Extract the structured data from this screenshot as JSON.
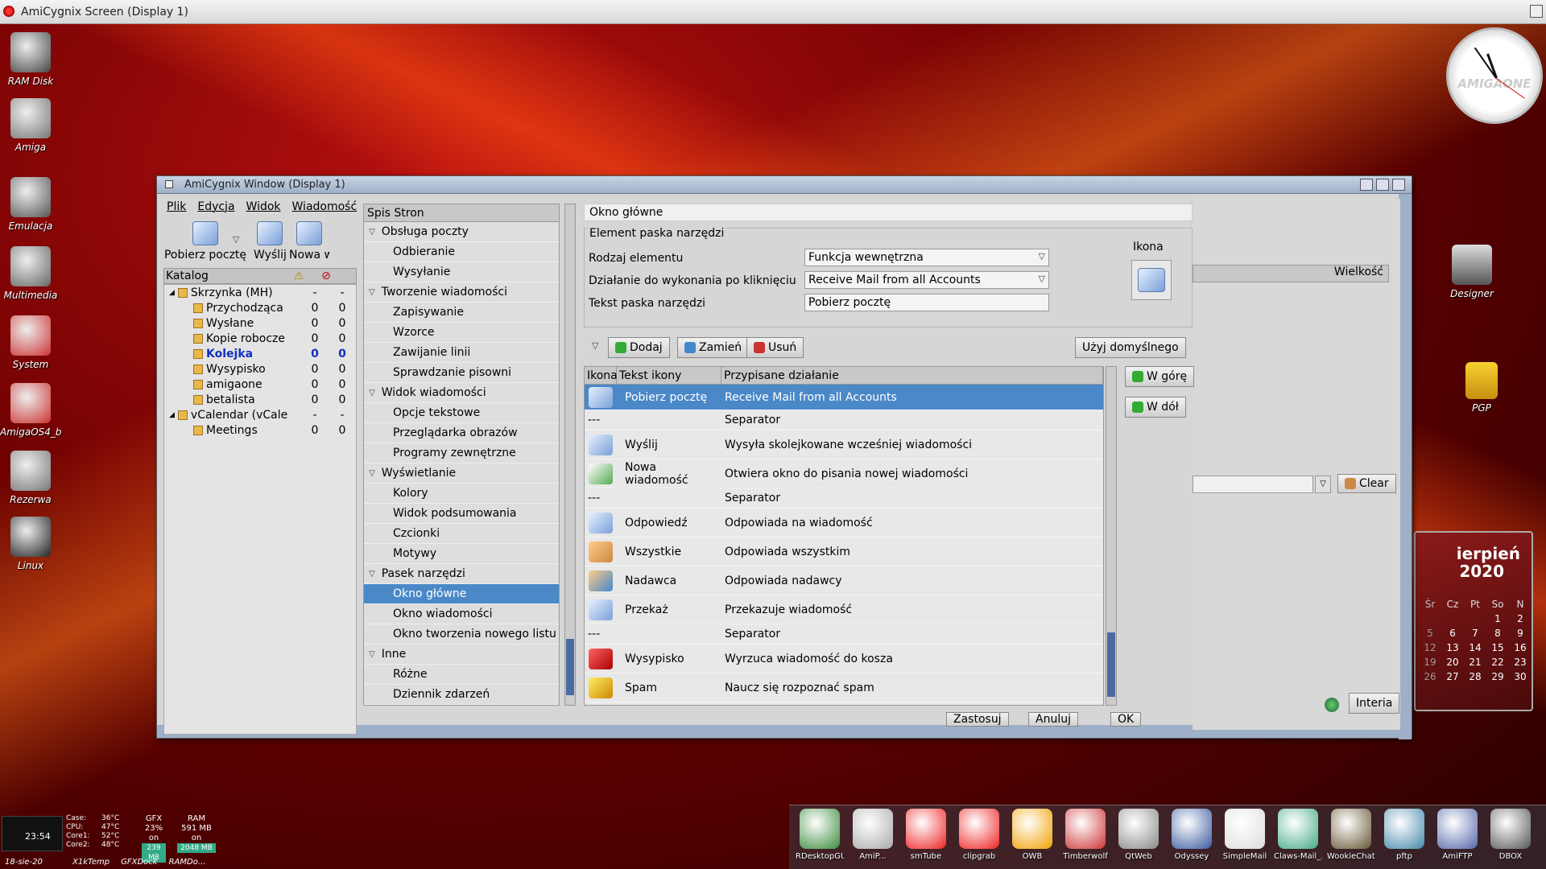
{
  "screen": {
    "title": "AmiCygnix Screen (Display 1)"
  },
  "desktop_icons": [
    {
      "label": "RAM Disk",
      "icon": "ramdisk-icon",
      "color": "#444"
    },
    {
      "label": "Amiga",
      "icon": "amiga-tools-icon",
      "color": "#777"
    },
    {
      "label": "Emulacja",
      "icon": "emulation-icon",
      "color": "#555"
    },
    {
      "label": "Multimedia",
      "icon": "film-reel-icon",
      "color": "#666"
    },
    {
      "label": "System",
      "icon": "boing-ball-icon",
      "color": "#c33"
    },
    {
      "label": "AmigaOS4_b",
      "icon": "boing-ball-icon",
      "color": "#c33"
    },
    {
      "label": "Rezerwa",
      "icon": "tools-icon",
      "color": "#777"
    },
    {
      "label": "Linux",
      "icon": "penguin-icon",
      "color": "#222"
    }
  ],
  "desktop_icons_right": [
    {
      "label": "Designer",
      "icon": "hollywood-clapper-icon"
    },
    {
      "label": "PGP",
      "icon": "padlock-icon"
    }
  ],
  "clock": {
    "brand": "AMIGAONE"
  },
  "calendar": {
    "month": "ierpień",
    "year": "2020",
    "days_header": [
      "Cz",
      "Pt",
      "So",
      "N"
    ],
    "weeks": [
      [
        "",
        "",
        "",
        "1",
        "2"
      ],
      [
        "5",
        "6",
        "7",
        "8",
        "9"
      ],
      [
        "12",
        "13",
        "14",
        "15",
        "16"
      ],
      [
        "19",
        "20",
        "21",
        "22",
        "23"
      ],
      [
        "26",
        "27",
        "28",
        "29",
        "30"
      ]
    ],
    "col_label": "Śr"
  },
  "window": {
    "title": "AmiCygnix Window (Display 1)",
    "menu": [
      "Plik",
      "Edycja",
      "Widok",
      "Wiadomość"
    ],
    "toolbar": [
      {
        "label": "Pobierz pocztę",
        "icon": "get-mail-icon"
      },
      {
        "label": "Wyślij",
        "icon": "send-mail-icon"
      },
      {
        "label": "Nowa w",
        "icon": "new-message-icon"
      }
    ],
    "folder_header": {
      "katalog": "Katalog"
    },
    "folders": [
      {
        "name": "Skrzynka (MH)",
        "a": "-",
        "b": "-",
        "indent": 0,
        "bold": false
      },
      {
        "name": "Przychodząca",
        "a": "0",
        "b": "0",
        "indent": 1,
        "bold": false
      },
      {
        "name": "Wysłane",
        "a": "0",
        "b": "0",
        "indent": 1,
        "bold": false
      },
      {
        "name": "Kopie robocze",
        "a": "0",
        "b": "0",
        "indent": 1,
        "bold": false
      },
      {
        "name": "Kolejka",
        "a": "0",
        "b": "0",
        "indent": 1,
        "bold": true
      },
      {
        "name": "Wysypisko",
        "a": "0",
        "b": "0",
        "indent": 1,
        "bold": false
      },
      {
        "name": "amigaone",
        "a": "0",
        "b": "0",
        "indent": 1,
        "bold": false
      },
      {
        "name": "betalista",
        "a": "0",
        "b": "0",
        "indent": 1,
        "bold": false
      },
      {
        "name": "vCalendar (vCale",
        "a": "-",
        "b": "-",
        "indent": 0,
        "bold": false
      },
      {
        "name": "Meetings",
        "a": "0",
        "b": "0",
        "indent": 1,
        "bold": false
      }
    ],
    "pages_header": "Spis Stron",
    "pages": [
      {
        "label": "Obsługa poczty",
        "type": "cat"
      },
      {
        "label": "Odbieranie",
        "type": "sub"
      },
      {
        "label": "Wysyłanie",
        "type": "sub"
      },
      {
        "label": "Tworzenie wiadomości",
        "type": "cat"
      },
      {
        "label": "Zapisywanie",
        "type": "sub"
      },
      {
        "label": "Wzorce",
        "type": "sub"
      },
      {
        "label": "Zawijanie linii",
        "type": "sub"
      },
      {
        "label": "Sprawdzanie pisowni",
        "type": "sub"
      },
      {
        "label": "Widok wiadomości",
        "type": "cat"
      },
      {
        "label": "Opcje tekstowe",
        "type": "sub"
      },
      {
        "label": "Przeglądarka obrazów",
        "type": "sub"
      },
      {
        "label": "Programy zewnętrzne",
        "type": "sub"
      },
      {
        "label": "Wyświetlanie",
        "type": "cat"
      },
      {
        "label": "Kolory",
        "type": "sub"
      },
      {
        "label": "Widok podsumowania",
        "type": "sub"
      },
      {
        "label": "Czcionki",
        "type": "sub"
      },
      {
        "label": "Motywy",
        "type": "sub"
      },
      {
        "label": "Pasek narzędzi",
        "type": "cat"
      },
      {
        "label": "Okno główne",
        "type": "sub",
        "selected": true
      },
      {
        "label": "Okno wiadomości",
        "type": "sub"
      },
      {
        "label": "Okno tworzenia nowego listu",
        "type": "sub"
      },
      {
        "label": "Inne",
        "type": "cat"
      },
      {
        "label": "Różne",
        "type": "sub"
      },
      {
        "label": "Dziennik zdarzeń",
        "type": "sub"
      }
    ],
    "panel": {
      "title": "Okno główne",
      "group_title": "Element paska narzędzi",
      "rodzaj_label": "Rodzaj elementu",
      "rodzaj_value": "Funkcja wewnętrzna",
      "dzialanie_label": "Działanie do wykonania po kliknięciu",
      "dzialanie_value": "Receive Mail from all Accounts",
      "tekst_label": "Tekst paska narzędzi",
      "tekst_value": "Pobierz pocztę",
      "ikona_label": "Ikona",
      "btn_dodaj": "Dodaj",
      "btn_zamien": "Zamień",
      "btn_usun": "Usuń",
      "btn_domyslne": "Użyj domyślnego",
      "btn_wgore": "W górę",
      "btn_wdol": "W dół",
      "col_ikona": "Ikona",
      "col_tekst": "Tekst ikony",
      "col_dzialanie": "Przypisane działanie",
      "btn_zastosuj": "Zastosuj",
      "btn_anuluj": "Anuluj",
      "btn_ok": "OK"
    },
    "rows": [
      {
        "text": "Pobierz pocztę",
        "action": "Receive Mail from all Accounts",
        "icon": "get-mail-icon",
        "selected": true,
        "sep": false
      },
      {
        "text": "---",
        "action": "Separator",
        "icon": "",
        "sep": true
      },
      {
        "text": "Wyślij",
        "action": "Wysyła skolejkowane wcześniej wiadomości",
        "icon": "send-mail-icon",
        "sep": false
      },
      {
        "text": "Nowa wiadomość",
        "action": "Otwiera okno do pisania nowej wiadomości",
        "icon": "new-message-icon",
        "sep": false
      },
      {
        "text": "---",
        "action": "Separator",
        "icon": "",
        "sep": true
      },
      {
        "text": "Odpowiedź",
        "action": "Odpowiada na wiadomość",
        "icon": "reply-icon",
        "sep": false
      },
      {
        "text": "Wszystkie",
        "action": "Odpowiada wszystkim",
        "icon": "reply-all-icon",
        "sep": false
      },
      {
        "text": "Nadawca",
        "action": "Odpowiada nadawcy",
        "icon": "reply-sender-icon",
        "sep": false
      },
      {
        "text": "Przekaż",
        "action": "Przekazuje wiadomość",
        "icon": "forward-icon",
        "sep": false
      },
      {
        "text": "---",
        "action": "Separator",
        "icon": "",
        "sep": true
      },
      {
        "text": "Wysypisko",
        "action": "Wyrzuca wiadomość do kosza",
        "icon": "trash-icon",
        "sep": false
      },
      {
        "text": "Spam",
        "action": "Naucz się rozpoznać spam",
        "icon": "spam-icon",
        "sep": false
      }
    ],
    "behind": {
      "wielkosc": "Wielkość",
      "clear": "Clear",
      "interia": "Interia"
    }
  },
  "dock": [
    {
      "label": "RDesktopGUI",
      "icon": "rdesktop-icon",
      "color": "#3a8a3a"
    },
    {
      "label": "AmiP...",
      "icon": "amip-icon",
      "color": "#aaa"
    },
    {
      "label": "smTube",
      "icon": "youtube-icon",
      "color": "#e22"
    },
    {
      "label": "clipgrab",
      "icon": "youtube-icon",
      "color": "#e22"
    },
    {
      "label": "OWB",
      "icon": "owb-icon",
      "color": "#f0a000"
    },
    {
      "label": "Timberwolf",
      "icon": "timberwolf-icon",
      "color": "#c33"
    },
    {
      "label": "QtWeb",
      "icon": "qtweb-icon",
      "color": "#888"
    },
    {
      "label": "Odyssey",
      "icon": "odyssey-icon",
      "color": "#3a5aa0"
    },
    {
      "label": "SimpleMail",
      "icon": "simplemail-icon",
      "color": "#ddd"
    },
    {
      "label": "Claws-Mail_...",
      "icon": "claws-mail-icon",
      "color": "#4a8"
    },
    {
      "label": "WookieChat...",
      "icon": "wookiechat-icon",
      "color": "#653"
    },
    {
      "label": "pftp",
      "icon": "pftp-icon",
      "color": "#48a"
    },
    {
      "label": "AmiFTP",
      "icon": "amiftp-icon",
      "color": "#56a"
    },
    {
      "label": "DBOX",
      "icon": "dbox-icon",
      "color": "#555"
    }
  ],
  "gauges": {
    "clock": "23:54",
    "date": "18-sie-20",
    "temps": [
      "Case:",
      "36°C",
      "CPU:",
      "47°C",
      "Core1:",
      "52°C",
      "Core2:",
      "48°C"
    ],
    "gfx": "GFX",
    "gfx_pct": "23%",
    "gfx_on": "on",
    "gfx_mem": "239 MB",
    "ram": "RAM",
    "ram_used": "591 MB",
    "ram_on": "on",
    "ram_total": "2048 MB",
    "labels": [
      "X1kTemp",
      "GFXDock",
      "RAMDo..."
    ]
  }
}
